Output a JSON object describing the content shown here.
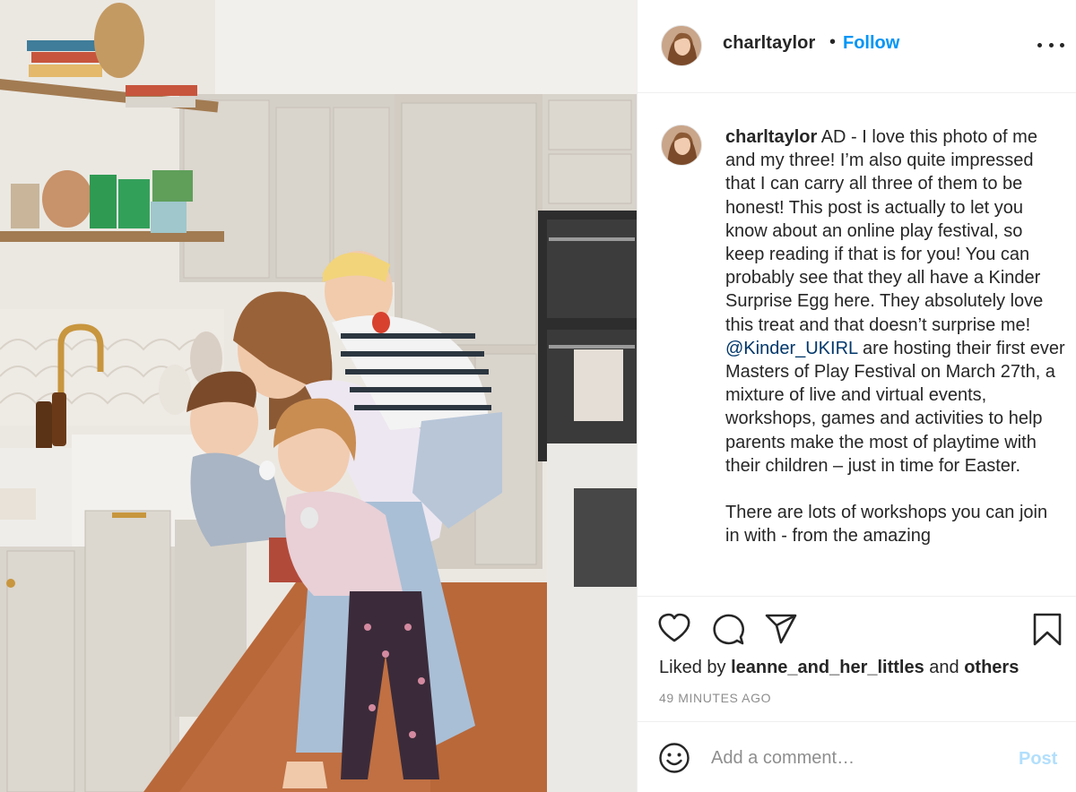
{
  "post": {
    "username": "charltaylor",
    "separator": "•",
    "follow_label": "Follow",
    "more_label": "More options",
    "photo_alt": "Mother hugging her three children in a kitchen"
  },
  "caption": {
    "username": "charltaylor",
    "text_part1": " AD - I love this photo of me and my three! I’m also quite impressed that I can carry all three of them to be honest! This post is actually to let you know about an online play festival, so keep reading if that is for you! You can probably see that they all have a Kinder Surprise Egg here. They absolutely love this treat and that doesn’t surprise me! ",
    "mention": "@Kinder_UKIRL",
    "text_part2": " are hosting their first ever Masters of Play Festival on March 27th, a mixture of live and virtual events, workshops, games and activities to help parents make the most of playtime with their children – just in time for Easter.",
    "paragraph2": "There are lots of workshops you can join in with - from the amazing"
  },
  "actions": {
    "like_icon": "heart-icon",
    "comment_icon": "speech-bubble-icon",
    "share_icon": "paper-plane-icon",
    "save_icon": "bookmark-icon"
  },
  "likes": {
    "prefix": "Liked by ",
    "user": "leanne_and_her_littles",
    "middle": " and ",
    "others": "others"
  },
  "timestamp": "49 MINUTES AGO",
  "comment_box": {
    "emoji_icon": "smiley-icon",
    "placeholder": "Add a comment…",
    "post_label": "Post"
  },
  "colors": {
    "link_blue": "#0095f6",
    "mention_blue": "#00376b",
    "post_disabled": "#b2dffc",
    "meta_gray": "#8e8e8e",
    "text": "#262626"
  }
}
